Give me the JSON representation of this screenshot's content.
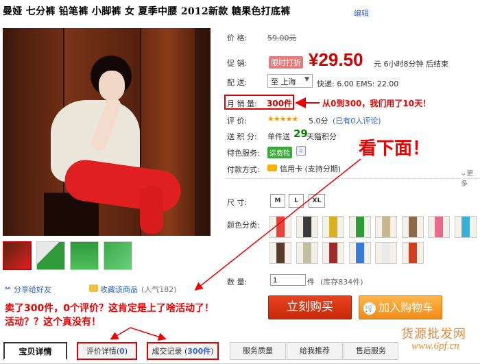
{
  "product": {
    "title": "曼娅  七分裤  铅笔裤  小脚裤  女  夏季中腰  2012新款  糖果色打底裤",
    "edit_label": "编辑"
  },
  "info": {
    "price_label": "价    格:",
    "price_original": "59.00元",
    "promo_label": "促    销:",
    "promo_badge": "限时打折",
    "promo_price": "¥29.50",
    "promo_time": "元 6小时8分钟 后结束",
    "delivery_label": "配    送:",
    "delivery_city": "至 上海",
    "shipping_fee": "快递: 6.00  EMS: 22.00",
    "monthly_label": "月 销 量:",
    "monthly_sales": "300件",
    "rating_label": "评    价:",
    "rating_stars": "★★★★★",
    "rating_score": "5.0分",
    "review_link": "(已有0人评论)",
    "points_label": "送 积 分:",
    "points_text": "单件送",
    "points_num": "29",
    "points_unit": "天猫积分",
    "service_label": "特色服务:",
    "service_badge": "运费险",
    "payment_label": "付款方式:",
    "payment_text": "信用卡 (支持分期)",
    "more": "更多"
  },
  "options": {
    "size_label": "尺    寸:",
    "sizes": [
      "M",
      "L",
      "XL"
    ],
    "color_label": "颜色分类:",
    "colors": [
      "#e8403a",
      "#3a3a3a",
      "#d8b020",
      "#2e9a3a",
      "#c8b890",
      "#8a6a4a",
      "#e86a8a",
      "#3ab0d8",
      "#5a3a2a",
      "#c0c0a0",
      "#a02a2a",
      "#3a7ad8",
      "#eaeaea",
      "#d04020"
    ],
    "qty_label": "数    量:",
    "qty_value": "1",
    "qty_unit": "件",
    "stock": "(库存834件)"
  },
  "actions": {
    "share": "分享给好友",
    "favorite": "收藏该商品",
    "favorite_popularity": "(人气182)",
    "buy_now": "立刻购买",
    "add_cart": "加入购物车"
  },
  "annotations": {
    "a1": "从0到300，我们用了10天！",
    "a2": "看下面！",
    "a3": "卖了300件，0个评价？这肯定是上了啥活动了！",
    "a4": "活动？？这个真没有！"
  },
  "tabs": [
    {
      "label": "宝贝详情"
    },
    {
      "label": "评价详情(",
      "count": "0",
      "close": ")"
    },
    {
      "label": "成交记录 (",
      "count": "300件",
      "close": ")"
    },
    {
      "label": "服务质量"
    },
    {
      "label": "给我推荐"
    },
    {
      "label": "售后服务"
    }
  ],
  "watermark": {
    "cn": "货源批发网",
    "url": "www.6pf.cn"
  }
}
